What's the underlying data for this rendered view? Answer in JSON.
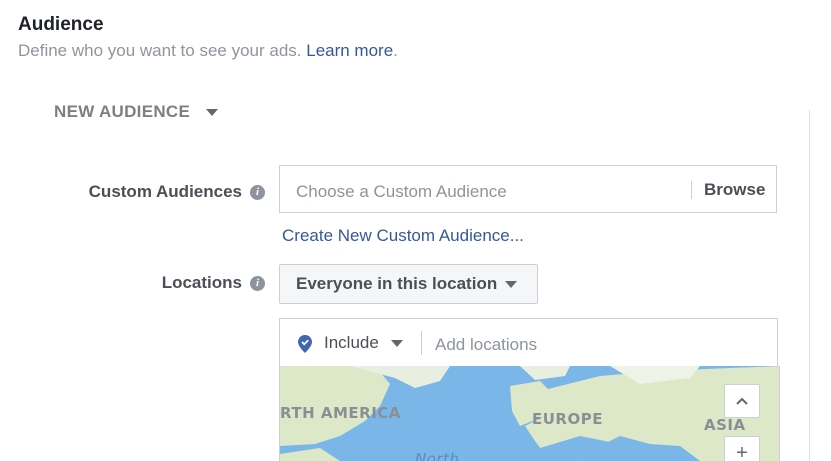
{
  "header": {
    "title": "Audience",
    "subtitle": "Define who you want to see your ads.",
    "learn_more": "Learn more",
    "subtitle_end": "."
  },
  "audience_selector": {
    "label": "NEW AUDIENCE"
  },
  "custom_audiences": {
    "label": "Custom Audiences",
    "placeholder": "Choose a Custom Audience",
    "browse_label": "Browse",
    "create_link": "Create New Custom Audience..."
  },
  "locations": {
    "label": "Locations",
    "dropdown_value": "Everyone in this location",
    "include_label": "Include",
    "add_placeholder": "Add locations"
  },
  "map": {
    "labels": [
      "RTH AMERICA",
      "EUROPE",
      "ASIA",
      "North"
    ],
    "zoom_up": "^",
    "zoom_in": "+"
  },
  "colors": {
    "link": "#365899",
    "ocean": "#7bb6e8",
    "land": "#dce8c8"
  }
}
